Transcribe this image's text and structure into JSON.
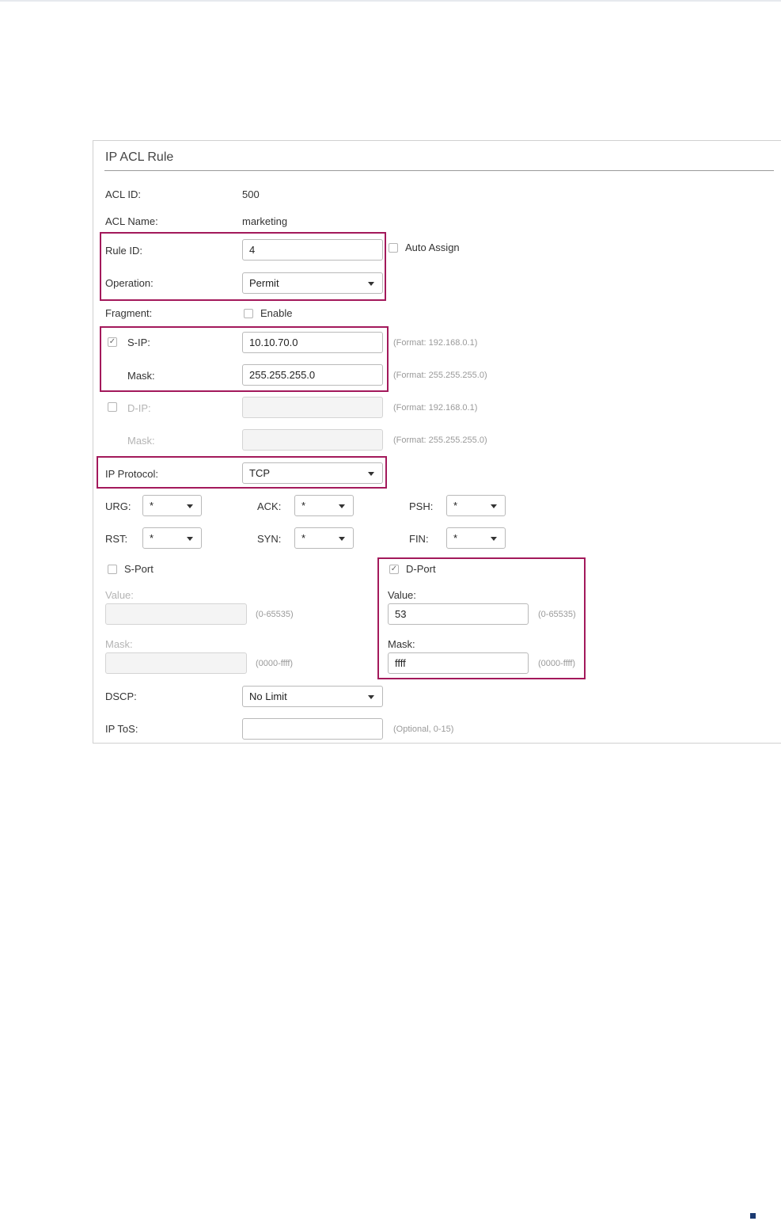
{
  "panel": {
    "title": "IP ACL Rule"
  },
  "acl_id": {
    "label": "ACL ID:",
    "value": "500"
  },
  "acl_name": {
    "label": "ACL Name:",
    "value": "marketing"
  },
  "rule_id": {
    "label": "Rule ID:",
    "value": "4",
    "auto_assign_label": "Auto Assign",
    "auto_assign_checked": false
  },
  "operation": {
    "label": "Operation:",
    "value": "Permit"
  },
  "fragment": {
    "label": "Fragment:",
    "enable_label": "Enable",
    "checked": false
  },
  "s_ip": {
    "checked": true,
    "check_glyph": "✓",
    "label": "S-IP:",
    "value": "10.10.70.0",
    "hint": "(Format: 192.168.0.1)",
    "mask_label": "Mask:",
    "mask_value": "255.255.255.0",
    "mask_hint": "(Format: 255.255.255.0)"
  },
  "d_ip": {
    "checked": false,
    "label": "D-IP:",
    "value": "",
    "hint": "(Format: 192.168.0.1)",
    "mask_label": "Mask:",
    "mask_value": "",
    "mask_hint": "(Format: 255.255.255.0)"
  },
  "ip_protocol": {
    "label": "IP Protocol:",
    "value": "TCP"
  },
  "tcp_flags": {
    "urg": {
      "label": "URG:",
      "value": "*"
    },
    "ack": {
      "label": "ACK:",
      "value": "*"
    },
    "psh": {
      "label": "PSH:",
      "value": "*"
    },
    "rst": {
      "label": "RST:",
      "value": "*"
    },
    "syn": {
      "label": "SYN:",
      "value": "*"
    },
    "fin": {
      "label": "FIN:",
      "value": "*"
    }
  },
  "s_port": {
    "label": "S-Port",
    "checked": false,
    "value_label": "Value:",
    "value": "",
    "value_hint": "(0-65535)",
    "mask_label": "Mask:",
    "mask_value": "",
    "mask_hint": "(0000-ffff)"
  },
  "d_port": {
    "label": "D-Port",
    "checked": true,
    "check_glyph": "✓",
    "value_label": "Value:",
    "value": "53",
    "value_hint": "(0-65535)",
    "mask_label": "Mask:",
    "mask_value": "ffff",
    "mask_hint": "(0000-ffff)"
  },
  "dscp": {
    "label": "DSCP:",
    "value": "No Limit"
  },
  "ip_tos": {
    "label": "IP ToS:",
    "value": "",
    "hint": "(Optional, 0-15)"
  },
  "colors": {
    "highlight": "#a3195b",
    "corner_mark": "#1b3a72"
  }
}
